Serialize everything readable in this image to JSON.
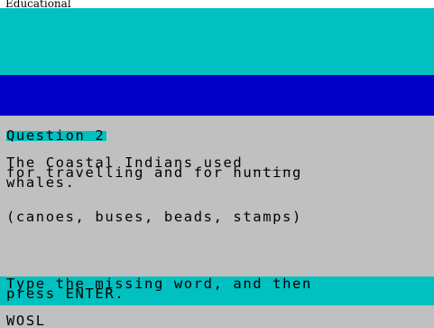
{
  "caption": "Educational",
  "quiz": {
    "title": "Question 2",
    "question_line1": "The Coastal Indians used ____",
    "question_line2": "for travelling and for hunting",
    "question_line3": "whales.",
    "options": "(canoes, buses, beads, stamps)",
    "prompt_line1": "Type the missing word, and then",
    "prompt_line2": "press ENTER.",
    "answer_value": "WOSL"
  },
  "colors": {
    "cyan": "#00c0c0",
    "blue": "#0000c8",
    "grey": "#c0c0c0"
  }
}
